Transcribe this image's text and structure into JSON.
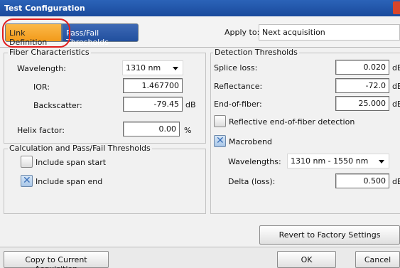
{
  "window": {
    "title": "Test Configuration"
  },
  "tabs": [
    {
      "label": "Link Definition",
      "active": true
    },
    {
      "label": "Pass/Fail Thresholds",
      "active": false
    }
  ],
  "apply_to": {
    "label": "Apply to:",
    "value": "Next acquisition"
  },
  "fiber": {
    "title": "Fiber Characteristics",
    "wavelength_label": "Wavelength:",
    "wavelength_value": "1310 nm",
    "ior_label": "IOR:",
    "ior_value": "1.467700",
    "backscatter_label": "Backscatter:",
    "backscatter_value": "-79.45",
    "backscatter_unit": "dB",
    "helix_label": "Helix factor:",
    "helix_value": "0.00",
    "helix_unit": "%"
  },
  "calc": {
    "title": "Calculation and Pass/Fail Thresholds",
    "span_start_label": "Include span start",
    "span_start_checked": false,
    "span_end_label": "Include span end",
    "span_end_checked": true
  },
  "detection": {
    "title": "Detection Thresholds",
    "splice_label": "Splice loss:",
    "splice_value": "0.020",
    "splice_unit": "dB",
    "reflectance_label": "Reflectance:",
    "reflectance_value": "-72.0",
    "reflectance_unit": "dB",
    "eof_label": "End-of-fiber:",
    "eof_value": "25.000",
    "eof_unit": "dB",
    "reflective_eof_label": "Reflective end-of-fiber detection",
    "reflective_eof_checked": false,
    "macrobend_label": "Macrobend",
    "macrobend_checked": true,
    "wavelengths_label": "Wavelengths:",
    "wavelengths_value": "1310 nm - 1550 nm",
    "delta_label": "Delta (loss):",
    "delta_value": "0.500",
    "delta_unit": "dB"
  },
  "buttons": {
    "revert": "Revert to Factory Settings",
    "copy": "Copy to Current Acquisition",
    "ok": "OK",
    "cancel": "Cancel"
  }
}
